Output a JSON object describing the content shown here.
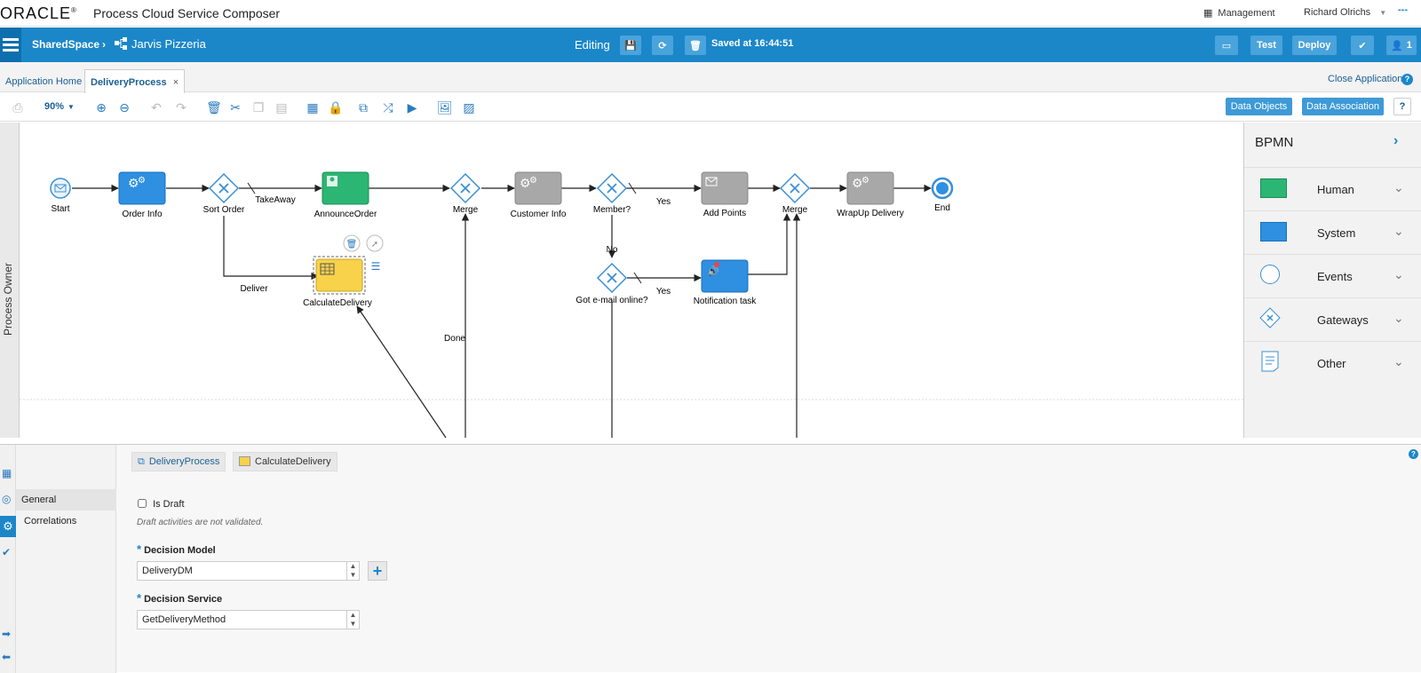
{
  "header": {
    "logo": "ORACLE",
    "logo_mark": "®",
    "app_title": "Process Cloud Service Composer",
    "management": "Management",
    "user": "Richard Olrichs"
  },
  "bluebar": {
    "space": "SharedSpace",
    "breadcrumb_sep": "›",
    "application": "Jarvis Pizzeria",
    "mode": "Editing",
    "saved": "Saved at 16:44:51",
    "test": "Test",
    "deploy": "Deploy",
    "user_count": "1",
    "more": "---"
  },
  "tabs": {
    "items": [
      {
        "label": "Application Home"
      },
      {
        "label": "DeliveryProcess"
      }
    ],
    "close_glyph": "×",
    "close_application": "Close Application",
    "help": "?"
  },
  "toolbar": {
    "zoom": "90%",
    "data_objects": "Data Objects",
    "data_association": "Data Association",
    "help": "?"
  },
  "lane": {
    "label": "Process Owner"
  },
  "diagram": {
    "nodes": {
      "start": "Start",
      "order_info": "Order Info",
      "sort_order": "Sort Order",
      "announce_order": "AnnounceOrder",
      "merge1": "Merge",
      "customer_info": "Customer Info",
      "member": "Member?",
      "add_points": "Add Points",
      "merge2": "Merge",
      "wrapup": "WrapUp Delivery",
      "end": "End",
      "calc_delivery": "CalculateDelivery",
      "got_email": "Got e-mail online?",
      "notification": "Notification task"
    },
    "flows": {
      "takeaway": "TakeAway",
      "deliver": "Deliver",
      "done": "Done",
      "yes1": "Yes",
      "no": "No",
      "yes2": "Yes"
    }
  },
  "palette": {
    "title": "BPMN",
    "items": [
      {
        "label": "Human",
        "color": "#2bb673"
      },
      {
        "label": "System",
        "color": "#2f8fe0"
      },
      {
        "label": "Events"
      },
      {
        "label": "Gateways"
      },
      {
        "label": "Other"
      }
    ]
  },
  "properties": {
    "crumbs": [
      "DeliveryProcess",
      "CalculateDelivery"
    ],
    "nav": [
      "General",
      "Correlations"
    ],
    "is_draft": "Is Draft",
    "draft_note": "Draft activities are not validated.",
    "required_mark": "*",
    "decision_model_label": "Decision Model",
    "decision_model_value": "DeliveryDM",
    "decision_service_label": "Decision Service",
    "decision_service_value": "GetDeliveryMethod",
    "help": "?"
  },
  "colors": {
    "accent": "#1b87c9",
    "human": "#2bb673",
    "system": "#2f8fe0",
    "service": "#a0a0a0",
    "business_rule": "#f7d24a"
  }
}
